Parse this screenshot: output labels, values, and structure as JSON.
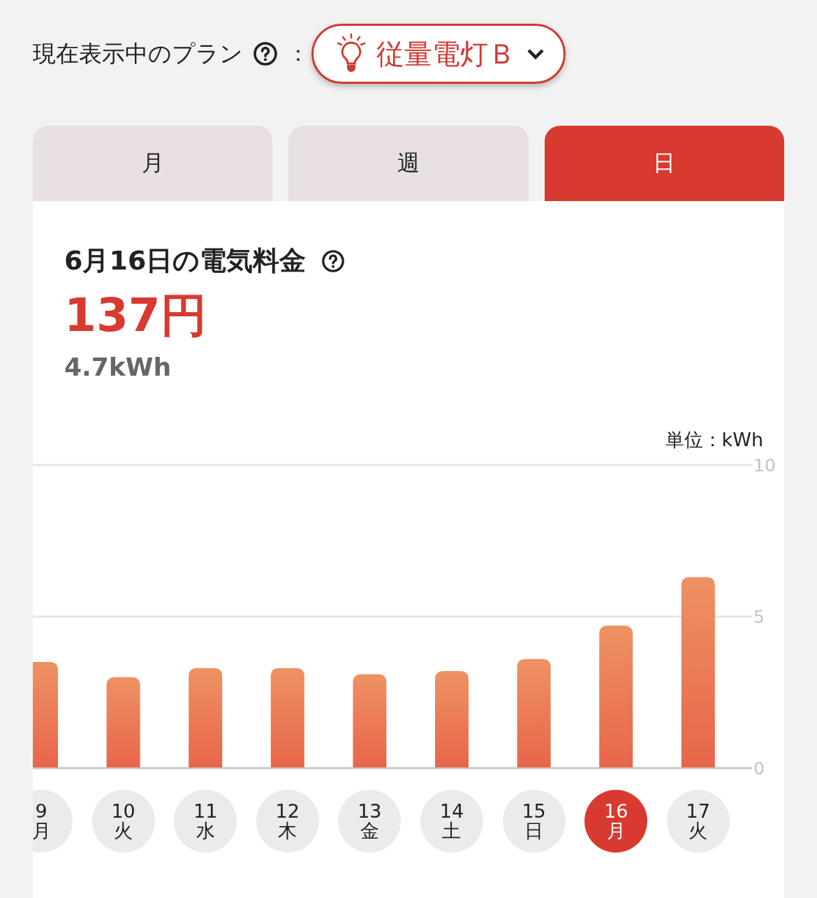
{
  "plan_selector": {
    "label": "現在表示中のプラン",
    "separator": "：",
    "value": "従量電灯Ｂ"
  },
  "tabs": [
    {
      "label": "月",
      "selected": false
    },
    {
      "label": "週",
      "selected": false
    },
    {
      "label": "日",
      "selected": true
    }
  ],
  "summary": {
    "title": "6月16日の電気料金",
    "amount": "137円",
    "usage": "4.7kWh"
  },
  "chart": {
    "unit_label": "単位：kWh",
    "chart_data": {
      "type": "bar",
      "categories": [
        "9",
        "10",
        "11",
        "12",
        "13",
        "14",
        "15",
        "16",
        "17"
      ],
      "values": [
        3.5,
        3.0,
        3.3,
        3.3,
        3.1,
        3.2,
        3.6,
        4.7,
        6.3
      ],
      "ylim": [
        0,
        10
      ],
      "yticks": [
        0,
        5,
        10
      ]
    },
    "day_buttons": [
      {
        "weekday": "月",
        "selected": false
      },
      {
        "weekday": "火",
        "selected": false
      },
      {
        "weekday": "水",
        "selected": false
      },
      {
        "weekday": "木",
        "selected": false
      },
      {
        "weekday": "金",
        "selected": false
      },
      {
        "weekday": "土",
        "selected": false
      },
      {
        "weekday": "日",
        "selected": false
      },
      {
        "weekday": "月",
        "selected": true
      },
      {
        "weekday": "火",
        "selected": false
      }
    ]
  }
}
